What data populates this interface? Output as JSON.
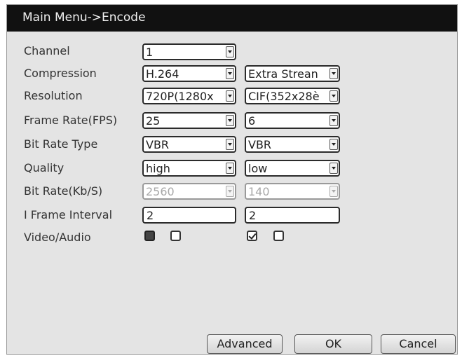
{
  "window": {
    "title": "Main Menu->Encode"
  },
  "labels": {
    "channel": "Channel",
    "compression": "Compression",
    "resolution": "Resolution",
    "frame_rate": "Frame Rate(FPS)",
    "bit_rate_type": "Bit Rate Type",
    "quality": "Quality",
    "bit_rate": "Bit Rate(Kb/S)",
    "i_frame_interval": "I Frame Interval",
    "video_audio": "Video/Audio"
  },
  "main_stream": {
    "channel": "1",
    "compression": "H.264",
    "resolution": "720P(1280x",
    "frame_rate": "25",
    "bit_rate_type": "VBR",
    "quality": "high",
    "bit_rate": "2560",
    "i_frame_interval": "2",
    "video_checked": true,
    "audio_checked": false
  },
  "extra_stream": {
    "compression": "Extra Strean",
    "resolution": "CIF(352x28è",
    "frame_rate": "6",
    "bit_rate_type": "VBR",
    "quality": "low",
    "bit_rate": "140",
    "i_frame_interval": "2",
    "video_checked": true,
    "audio_checked": false
  },
  "buttons": {
    "advanced": "Advanced",
    "ok": "OK",
    "cancel": "Cancel"
  },
  "icons": {
    "dropdown": "chevron-down-icon",
    "checkbox": "checkbox-icon"
  },
  "colors": {
    "titlebar": "#111111",
    "panel": "#e4e4e4"
  }
}
